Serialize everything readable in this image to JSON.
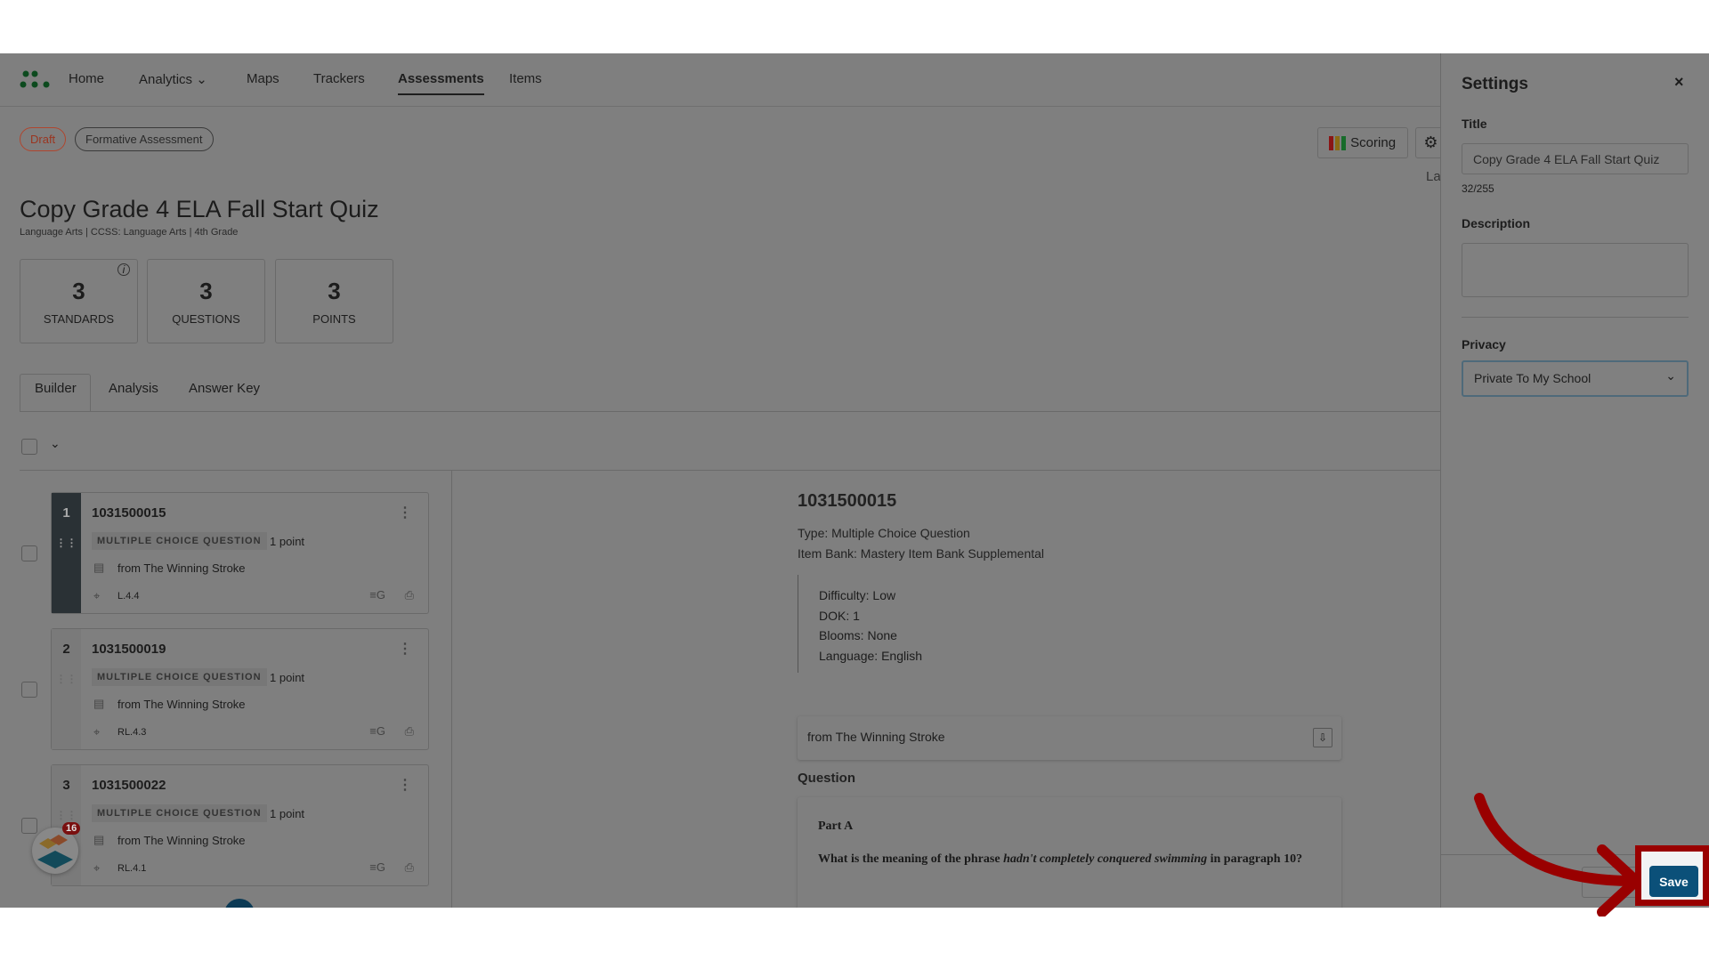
{
  "nav": {
    "items": [
      "Home",
      "Analytics",
      "Maps",
      "Trackers",
      "Assessments",
      "Items"
    ],
    "active": "Assessments"
  },
  "badges": {
    "status": "Draft",
    "type": "Formative Assessment"
  },
  "header": {
    "title": "Copy Grade 4 ELA Fall Start Quiz",
    "subtitle": "Language Arts | CCSS: Language Arts | 4th Grade",
    "scoring": "Scoring",
    "truncated": "La"
  },
  "stats": [
    {
      "value": "3",
      "label": "STANDARDS"
    },
    {
      "value": "3",
      "label": "QUESTIONS"
    },
    {
      "value": "3",
      "label": "POINTS"
    }
  ],
  "tabs": [
    "Builder",
    "Analysis",
    "Answer Key"
  ],
  "questions": [
    {
      "n": "1",
      "id": "1031500015",
      "type": "MULTIPLE CHOICE QUESTION",
      "points": "1 point",
      "source": "from The Winning Stroke",
      "standard": "L.4.4"
    },
    {
      "n": "2",
      "id": "1031500019",
      "type": "MULTIPLE CHOICE QUESTION",
      "points": "1 point",
      "source": "from The Winning Stroke",
      "standard": "RL.4.3"
    },
    {
      "n": "3",
      "id": "1031500022",
      "type": "MULTIPLE CHOICE QUESTION",
      "points": "1 point",
      "source": "from The Winning Stroke",
      "standard": "RL.4.1"
    }
  ],
  "notification_count": "16",
  "detail": {
    "id": "1031500015",
    "type": "Type: Multiple Choice Question",
    "bank": "Item Bank: Mastery Item Bank Supplemental",
    "meta": [
      "Difficulty: Low",
      "DOK: 1",
      "Blooms: None",
      "Language: English"
    ],
    "passage": "from The Winning Stroke",
    "question_label": "Question",
    "part": "Part A",
    "q_pre": "What is the meaning of the phrase ",
    "q_em": "hadn't completely conquered swimming",
    "q_post": " in paragraph 10?"
  },
  "settings": {
    "heading": "Settings",
    "title_label": "Title",
    "title_value": "Copy Grade 4 ELA Fall Start Quiz",
    "count": "32/255",
    "description_label": "Description",
    "description_value": "",
    "privacy_label": "Privacy",
    "privacy_value": "Private To My School",
    "save": "Save"
  },
  "colors": {
    "overlay_bg": "#7f7f7f",
    "draft": "#c0472b",
    "save": "#0b5079",
    "highlight": "#990000"
  }
}
